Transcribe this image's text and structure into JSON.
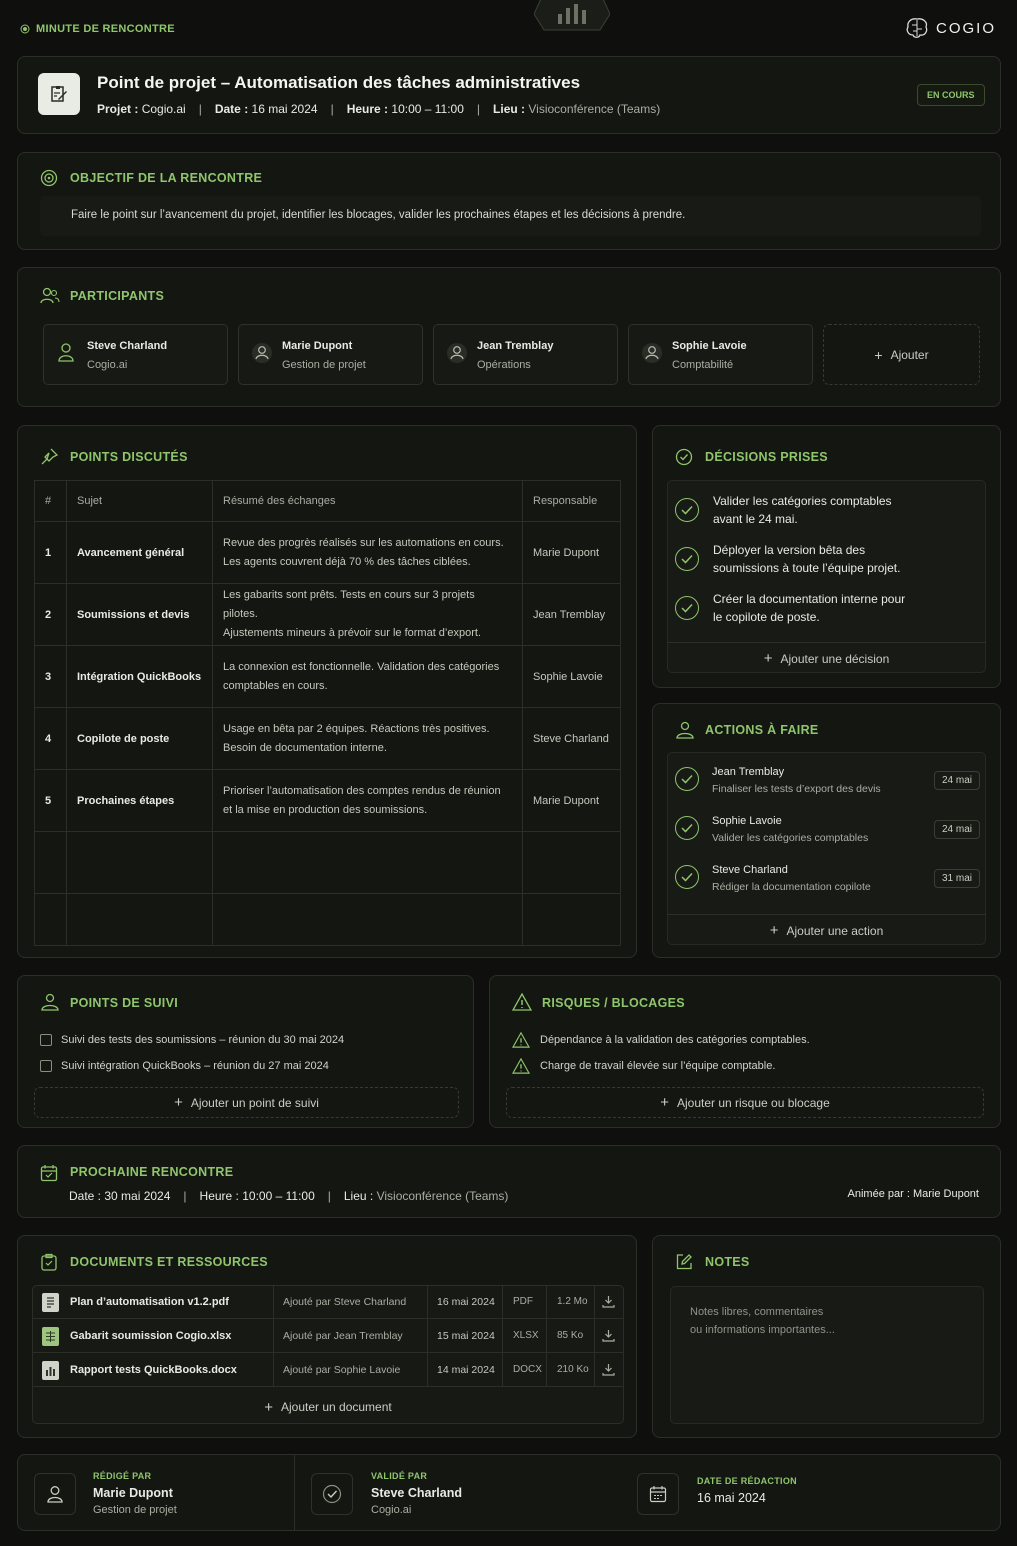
{
  "header": {
    "tag": "MINUTE DE RENCONTRE",
    "brand": "COGIO"
  },
  "meeting": {
    "title": "Point de projet – Automatisation des tâches administratives",
    "project_label": "Projet :",
    "project": "Cogio.ai",
    "date_label": "Date :",
    "date": "16 mai 2024",
    "time_label": "Heure :",
    "time": "10:00 – 11:00",
    "place_label": "Lieu :",
    "place": "Visioconférence (Teams)",
    "status": "EN COURS"
  },
  "objective": {
    "title": "OBJECTIF DE LA RENCONTRE",
    "text": "Faire le point sur l’avancement du projet, identifier les blocages, valider les prochaines étapes et les décisions à prendre."
  },
  "participants": {
    "title": "PARTICIPANTS",
    "add": "Ajouter",
    "items": [
      {
        "name": "Steve Charland",
        "role": "Cogio.ai"
      },
      {
        "name": "Marie Dupont",
        "role": "Gestion de projet"
      },
      {
        "name": "Jean Tremblay",
        "role": "Opérations"
      },
      {
        "name": "Sophie Lavoie",
        "role": "Comptabilité"
      }
    ]
  },
  "points": {
    "title": "POINTS DISCUTÉS",
    "headers": [
      "#",
      "Sujet",
      "Résumé des échanges",
      "Responsable"
    ],
    "rows": [
      {
        "n": "1",
        "subject": "Avancement général",
        "summary1": "Revue des progrès réalisés sur les automations en cours.",
        "summary2": "Les agents couvrent déjà 70 % des tâches ciblées.",
        "owner": "Marie Dupont"
      },
      {
        "n": "2",
        "subject": "Soumissions et devis",
        "summary1": "Les gabarits sont prêts. Tests en cours sur 3 projets pilotes.",
        "summary2": "Ajustements mineurs à prévoir sur le format d’export.",
        "owner": "Jean Tremblay"
      },
      {
        "n": "3",
        "subject": "Intégration QuickBooks",
        "summary1": "La connexion est fonctionnelle. Validation des catégories",
        "summary2": "comptables en cours.",
        "owner": "Sophie Lavoie"
      },
      {
        "n": "4",
        "subject": "Copilote de poste",
        "summary1": "Usage en bêta par 2 équipes. Réactions très positives.",
        "summary2": "Besoin de documentation interne.",
        "owner": "Steve Charland"
      },
      {
        "n": "5",
        "subject": "Prochaines étapes",
        "summary1": "Prioriser l’automatisation des comptes rendus de réunion",
        "summary2": "et la mise en production des soumissions.",
        "owner": "Marie Dupont"
      }
    ]
  },
  "decisions": {
    "title": "DÉCISIONS PRISES",
    "add": "Ajouter une décision",
    "items": [
      {
        "l1": "Valider les catégories comptables",
        "l2": "avant le 24 mai."
      },
      {
        "l1": "Déployer la version bêta des",
        "l2": "soumissions à toute l’équipe projet."
      },
      {
        "l1": "Créer la documentation interne pour",
        "l2": "le copilote de poste."
      }
    ]
  },
  "actions": {
    "title": "ACTIONS À FAIRE",
    "add": "Ajouter une action",
    "items": [
      {
        "who": "Jean Tremblay",
        "what": "Finaliser les tests d’export des devis",
        "due": "24 mai"
      },
      {
        "who": "Sophie Lavoie",
        "what": "Valider les catégories comptables",
        "due": "24 mai"
      },
      {
        "who": "Steve Charland",
        "what": "Rédiger la documentation copilote",
        "due": "31 mai"
      }
    ]
  },
  "followup": {
    "title": "POINTS DE SUIVI",
    "add": "Ajouter un point de suivi",
    "items": [
      "Suivi des tests des soumissions – réunion du 30 mai 2024",
      "Suivi intégration QuickBooks – réunion du 27 mai 2024"
    ]
  },
  "risks": {
    "title": "RISQUES / BLOCAGES",
    "add": "Ajouter un risque ou blocage",
    "items": [
      "Dépendance à la validation des catégories comptables.",
      "Charge de travail élevée sur l’équipe comptable."
    ]
  },
  "next": {
    "title": "PROCHAINE RENCONTRE",
    "date_label": "Date :",
    "date": "30 mai 2024",
    "time_label": "Heure :",
    "time": "10:00 – 11:00",
    "place_label": "Lieu :",
    "place": "Visioconférence (Teams)",
    "host_label": "Animée par :",
    "host": "Marie Dupont"
  },
  "documents": {
    "title": "DOCUMENTS ET RESSOURCES",
    "add": "Ajouter un document",
    "items": [
      {
        "name": "Plan d’automatisation v1.2.pdf",
        "added_label": "Ajouté par",
        "added": "Steve Charland",
        "date": "16 mai 2024",
        "type": "PDF",
        "size": "1.2 Mo"
      },
      {
        "name": "Gabarit soumission Cogio.xlsx",
        "added_label": "Ajouté par",
        "added": "Jean Tremblay",
        "date": "15 mai 2024",
        "type": "XLSX",
        "size": "85 Ko"
      },
      {
        "name": "Rapport tests QuickBooks.docx",
        "added_label": "Ajouté par",
        "added": "Sophie Lavoie",
        "date": "14 mai 2024",
        "type": "DOCX",
        "size": "210 Ko"
      }
    ]
  },
  "notes": {
    "title": "NOTES",
    "placeholder_l1": "Notes libres, commentaires",
    "placeholder_l2": "ou informations importantes..."
  },
  "footer": {
    "written_label": "RÉDIGÉ PAR",
    "written_name": "Marie Dupont",
    "written_role": "Gestion de projet",
    "validated_label": "VALIDÉ PAR",
    "validated_name": "Steve Charland",
    "validated_role": "Cogio.ai",
    "date_label": "DATE DE RÉDACTION",
    "date": "16 mai 2024"
  }
}
